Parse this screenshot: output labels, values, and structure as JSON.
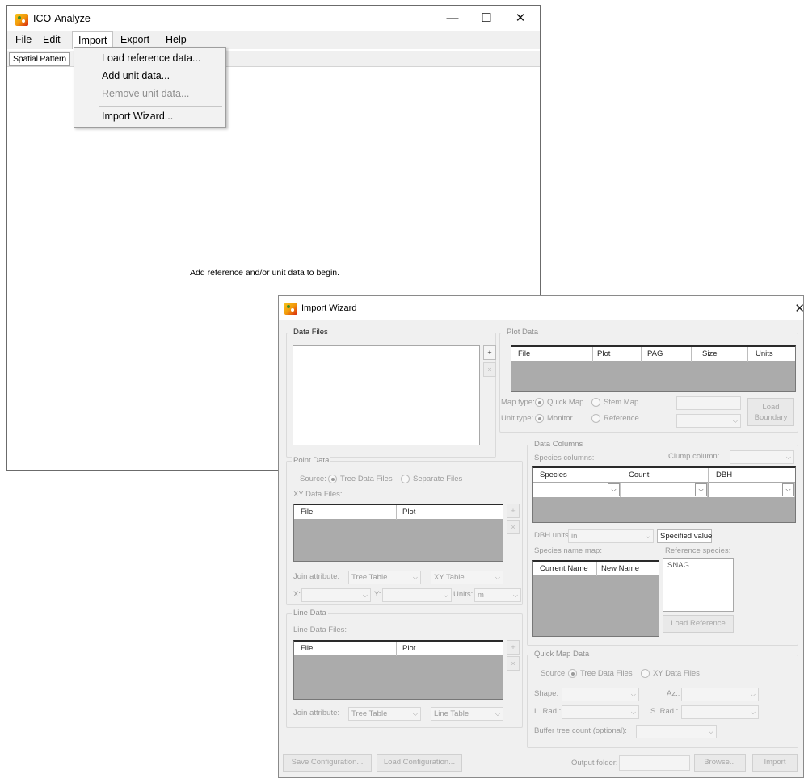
{
  "main_window": {
    "title": "ICO-Analyze",
    "controls": {
      "minimize": "—",
      "maximize": "☐",
      "close": "✕"
    },
    "menu": [
      "File",
      "Edit",
      "Import",
      "Export",
      "Help"
    ],
    "tab": "Spatial Pattern",
    "message": "Add reference and/or unit data to begin."
  },
  "import_menu": {
    "items": [
      "Load reference data...",
      "Add unit data...",
      "Remove unit data...",
      "Import Wizard..."
    ]
  },
  "wizard": {
    "title": "Import Wizard",
    "close": "✕",
    "data_files": {
      "title": "Data Files",
      "add_btn": "+",
      "remove_btn": "×"
    },
    "plot_data": {
      "title": "Plot Data",
      "columns": [
        "File",
        "Plot",
        "PAG",
        "Size",
        "Units"
      ],
      "map_type_label": "Map type:",
      "map_type_options": [
        "Quick Map",
        "Stem Map"
      ],
      "unit_type_label": "Unit type:",
      "unit_type_options": [
        "Monitor",
        "Reference"
      ],
      "load_boundary_line1": "Load",
      "load_boundary_line2": "Boundary"
    },
    "point_data": {
      "title": "Point Data",
      "source_label": "Source:",
      "source_options": [
        "Tree Data Files",
        "Separate Files"
      ],
      "xy_files_label": "XY Data Files:",
      "columns": [
        "File",
        "Plot"
      ],
      "join_label": "Join attribute:",
      "join_left": "Tree Table",
      "join_right": "XY Table",
      "x_label": "X:",
      "y_label": "Y:",
      "units_label": "Units:",
      "units_value": "m"
    },
    "line_data": {
      "title": "Line Data",
      "files_label": "Line Data Files:",
      "columns": [
        "File",
        "Plot"
      ],
      "join_label": "Join attribute:",
      "join_left": "Tree Table",
      "join_right": "Line Table"
    },
    "data_columns": {
      "title": "Data Columns",
      "species_columns_label": "Species columns:",
      "clump_column_label": "Clump column:",
      "columns": [
        "Species",
        "Count",
        "DBH"
      ],
      "dbh_units_label": "DBH units:",
      "dbh_units_value": "in",
      "specified_value": "Specified value",
      "species_map_label": "Species name map:",
      "map_columns": [
        "Current Name",
        "New Name"
      ],
      "reference_species_label": "Reference species:",
      "reference_species": [
        "SNAG"
      ],
      "load_reference": "Load Reference"
    },
    "quick_map": {
      "title": "Quick Map Data",
      "source_label": "Source:",
      "source_options": [
        "Tree Data Files",
        "XY Data Files"
      ],
      "shape_label": "Shape:",
      "az_label": "Az.:",
      "lrad_label": "L. Rad.:",
      "srad_label": "S. Rad.:",
      "buffer_label": "Buffer tree count (optional):"
    },
    "bottom": {
      "save_config": "Save Configuration...",
      "load_config": "Load Configuration...",
      "output_folder_label": "Output folder:",
      "browse": "Browse...",
      "import": "Import"
    }
  }
}
